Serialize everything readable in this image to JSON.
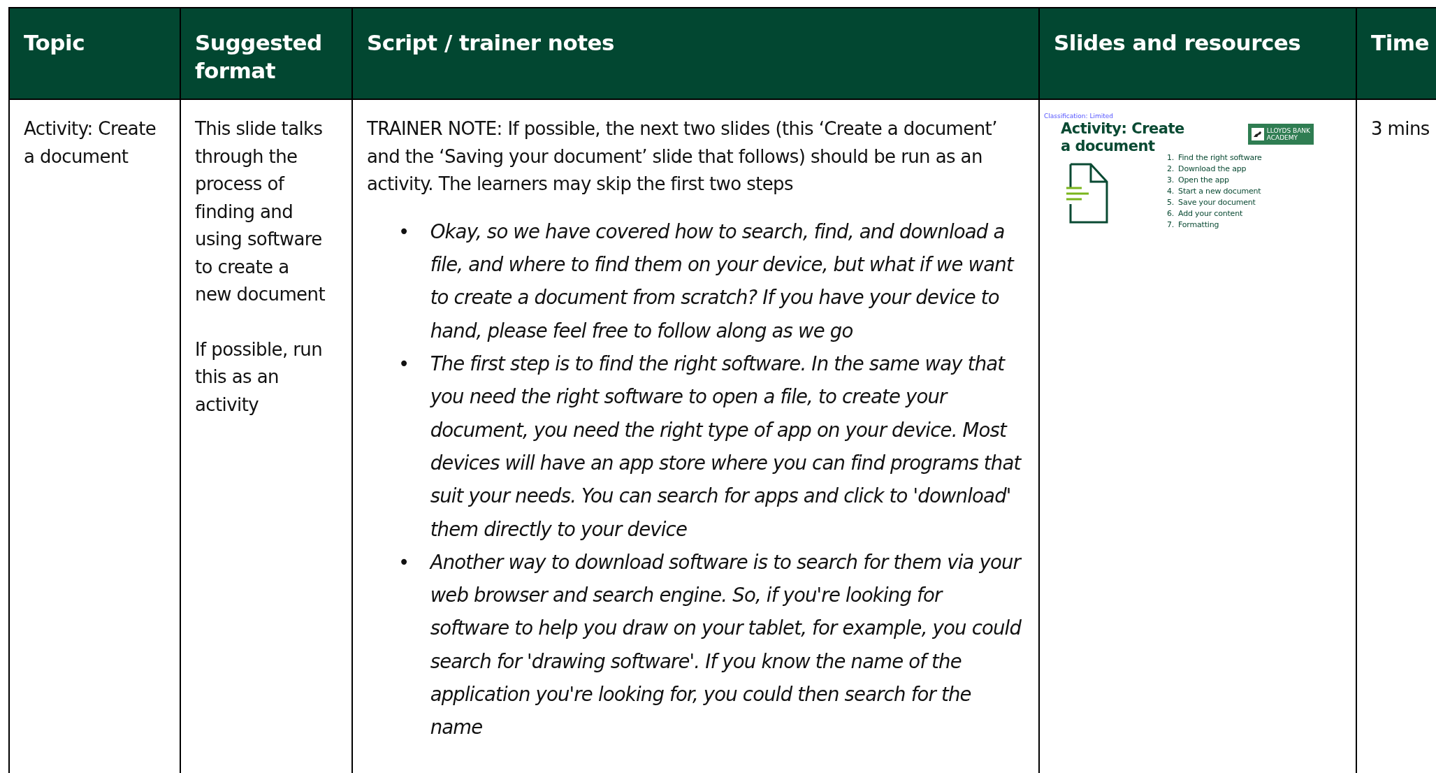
{
  "table": {
    "columns": [
      "Topic",
      "Suggested format",
      "Script / trainer notes",
      "Slides and resources",
      "Time"
    ],
    "rows": [
      {
        "topic": "Activity: Create a document",
        "format": [
          "This slide talks through the process of finding and using software to create a new document",
          "If possible, run this as an activity"
        ],
        "notes": {
          "intro": "TRAINER NOTE: If possible, the next two slides (this ‘Create a document’ and the ‘Saving your document’ slide that follows) should be run as an activity. The learners may skip the first two steps",
          "bullets": [
            {
              "marker": "•",
              "text": "Okay, so we have covered how to search, find, and download a file, and where to find them on your device, but what if we want to create a document from scratch? If you have your device to hand, please feel free to follow along as we go"
            },
            {
              "marker": "•",
              "text": "The first step is to find the right software. In the same way that you need the right software to open a file, to create your document, you need the right type of app on your device. Most devices will have an app store where you can find programs that suit your needs. You can search for apps and click to 'download' them directly to your device"
            },
            {
              "marker": "•",
              "text": "Another way to download software is to search for them via your web browser and search engine. So, if you're looking for software to help you draw on your tablet, for example, you could search for 'drawing software'. If you know the name of the application you're looking for, you could then search for the name"
            }
          ]
        },
        "slide": {
          "classification": "Classification: Limited",
          "title": "Activity: Create a document",
          "logo_line1": "LLOYDS BANK",
          "logo_line2": "ACADEMY",
          "steps": [
            {
              "number": "1.",
              "text": "Find the right software"
            },
            {
              "number": "2.",
              "text": "Download the app"
            },
            {
              "number": "3.",
              "text": "Open the app"
            },
            {
              "number": "4.",
              "text": "Start a new document"
            },
            {
              "number": "5.",
              "text": "Save your document"
            },
            {
              "number": "6.",
              "text": "Add your content"
            },
            {
              "number": "7.",
              "text": "Formatting"
            }
          ]
        },
        "time": "3 mins"
      }
    ]
  }
}
